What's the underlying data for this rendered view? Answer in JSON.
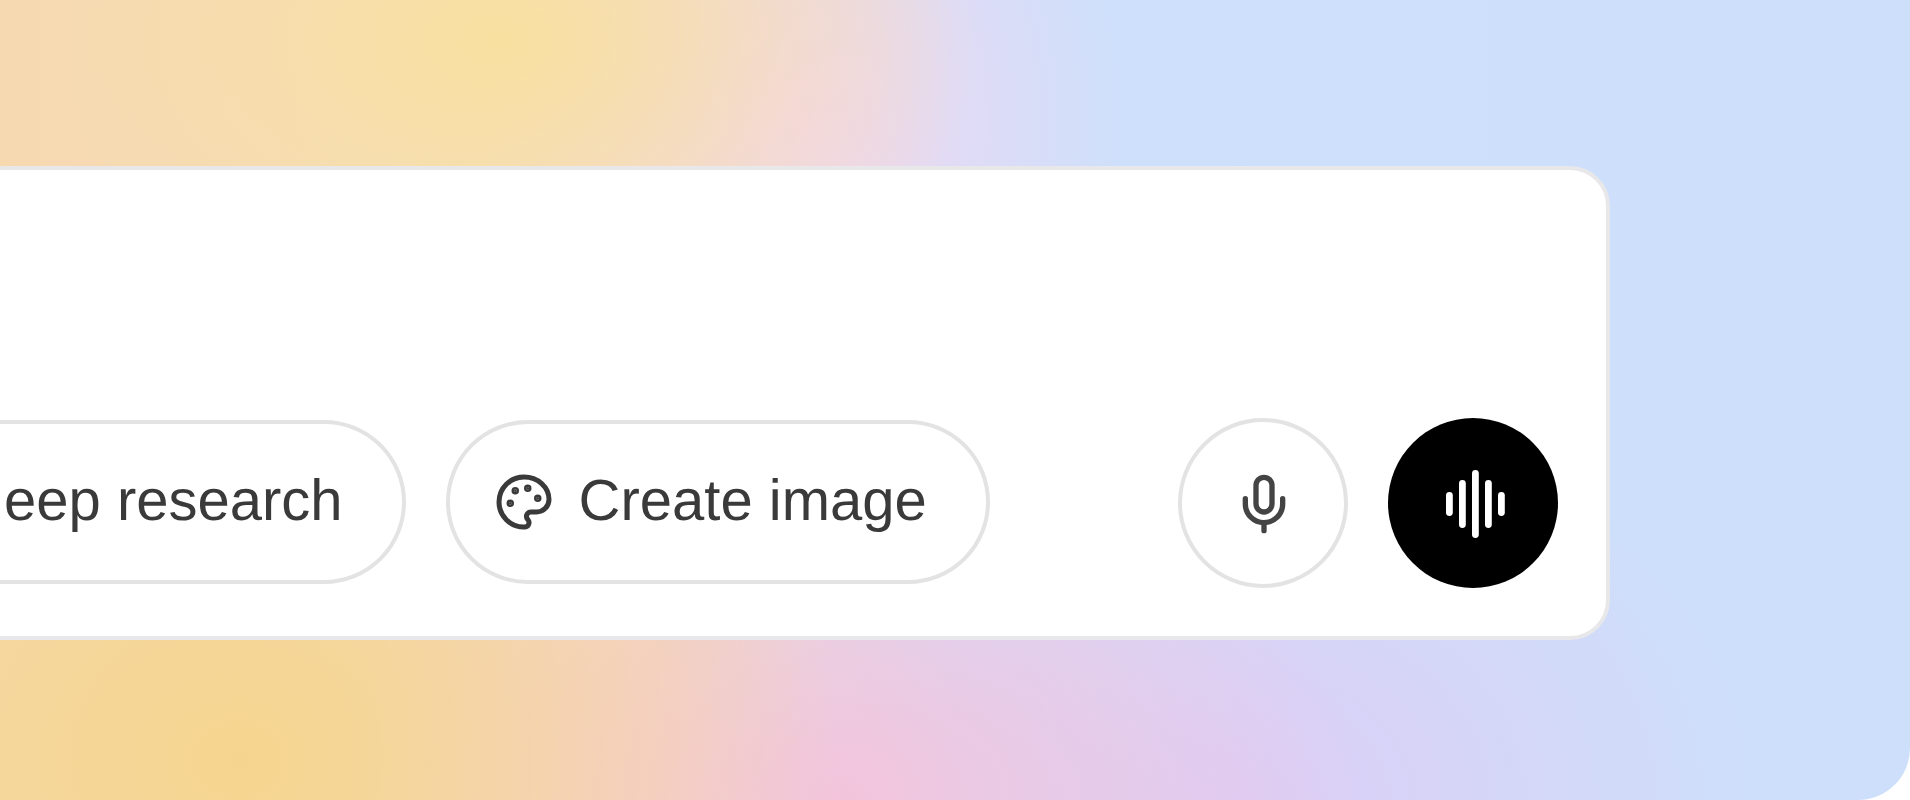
{
  "composer": {
    "tools": [
      {
        "label": "eep research",
        "kind": "plain"
      },
      {
        "label": "Create image",
        "kind": "image"
      }
    ],
    "actions": [
      {
        "kind": "mic"
      },
      {
        "kind": "voice"
      }
    ]
  }
}
